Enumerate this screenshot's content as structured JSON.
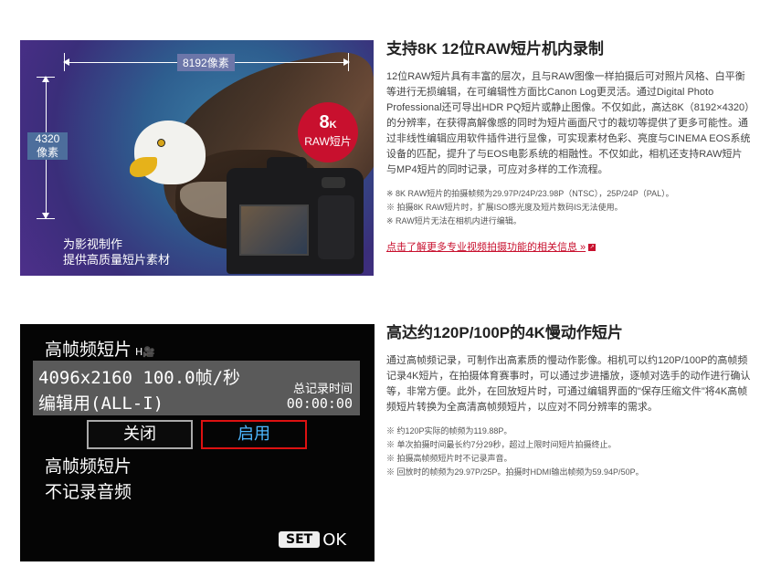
{
  "section1": {
    "image": {
      "width_label": "8192像素",
      "height_label_line1": "4320",
      "height_label_line2": "像素",
      "badge_big": "8",
      "badge_small": "K",
      "badge_text": "RAW短片",
      "caption_line1": "为影视制作",
      "caption_line2": "提供高质量短片素材"
    },
    "title": "支持8K 12位RAW短片机内录制",
    "paragraph": "12位RAW短片具有丰富的层次，且与RAW图像一样拍摄后可对照片风格、白平衡等进行无损编辑，在可编辑性方面比Canon Log更灵活。通过Digital Photo Professional还可导出HDR PQ短片或静止图像。不仅如此，高达8K（8192×4320）的分辨率，在获得高解像感的同时为短片画面尺寸的裁切等提供了更多可能性。通过非线性编辑应用软件插件进行显像，可实现素材色彩、亮度与CINEMA EOS系统设备的匹配，提升了与EOS电影系统的相融性。不仅如此，相机还支持RAW短片与MP4短片的同时记录，可应对多样的工作流程。",
    "notes": [
      "※ 8K RAW短片的拍摄帧频为29.97P/24P/23.98P（NTSC），25P/24P（PAL）。",
      "※ 拍摄8K RAW短片时，扩展ISO感光度及短片数码IS无法使用。",
      "※ RAW短片无法在相机内进行编辑。"
    ],
    "link_text": "点击了解更多专业视频拍摄功能的相关信息 »"
  },
  "section2": {
    "menu": {
      "title": "高帧频短片",
      "title_icon": "H🎥",
      "line1": "4096x2160 100.0帧/秒",
      "line2": "编辑用(ALL-I)",
      "rec_label": "总记录时间",
      "rec_time": "00:00:00",
      "option_off": "关闭",
      "option_on": "启用",
      "desc_line1": "高帧频短片",
      "desc_line2": "不记录音频",
      "set_label": "SET",
      "ok_label": "OK"
    },
    "title": "高达约120P/100P的4K慢动作短片",
    "paragraph": "通过高帧频记录，可制作出高素质的慢动作影像。相机可以约120P/100P的高帧频记录4K短片，在拍摄体育赛事时，可以通过步进播放，逐帧对选手的动作进行确认等，非常方便。此外，在回放短片时，可通过编辑界面的\"保存压缩文件\"将4K高帧频短片转换为全高清高帧频短片，以应对不同分辨率的需求。",
    "notes": [
      "※ 约120P实际的帧频为119.88P。",
      "※ 单次拍摄时间最长约7分29秒，超过上限时间短片拍摄终止。",
      "※ 拍摄高帧频短片时不记录声音。",
      "※ 回放时的帧频为29.97P/25P。拍摄时HDMI输出帧频为59.94P/50P。"
    ]
  }
}
